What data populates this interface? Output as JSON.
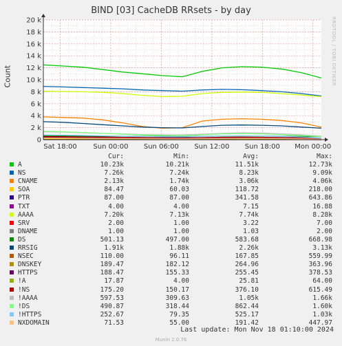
{
  "chart_data": {
    "type": "line",
    "title": "BIND [03] CacheDB RRsets - by day",
    "ylabel": "Count",
    "watermark": "RRDTOOL / TOBI OETIKER",
    "ylim": [
      0,
      20000
    ],
    "y_ticks": [
      {
        "value": 0,
        "label": "0"
      },
      {
        "value": 2000,
        "label": "2 k"
      },
      {
        "value": 4000,
        "label": "4 k"
      },
      {
        "value": 6000,
        "label": "6 k"
      },
      {
        "value": 8000,
        "label": "8 k"
      },
      {
        "value": 10000,
        "label": "10 k"
      },
      {
        "value": 12000,
        "label": "12 k"
      },
      {
        "value": 14000,
        "label": "14 k"
      },
      {
        "value": 16000,
        "label": "16 k"
      },
      {
        "value": 18000,
        "label": "18 k"
      },
      {
        "value": 20000,
        "label": "20 k"
      }
    ],
    "x_range_hours": [
      0,
      33
    ],
    "x_ticks": [
      {
        "hour": 2,
        "label": "Sat 18:00"
      },
      {
        "hour": 8,
        "label": "Sun 00:00"
      },
      {
        "hour": 14,
        "label": "Sun 06:00"
      },
      {
        "hour": 20,
        "label": "Sun 12:00"
      },
      {
        "hour": 26,
        "label": "Sun 18:00"
      },
      {
        "hour": 32,
        "label": "Mon 00:00"
      }
    ],
    "grid": true,
    "columns": [
      "Cur:",
      "Min:",
      "Avg:",
      "Max:"
    ],
    "series": [
      {
        "name": "A",
        "color": "#00cc00",
        "values": [
          12500,
          12300,
          12100,
          11700,
          11300,
          11000,
          10700,
          10500,
          11400,
          12000,
          12200,
          12100,
          11800,
          11200,
          10300
        ]
      },
      {
        "name": "NS",
        "color": "#0066b3",
        "values": [
          8900,
          8800,
          8700,
          8600,
          8500,
          8300,
          8200,
          8100,
          8300,
          8400,
          8350,
          8200,
          8000,
          7700,
          7300
        ]
      },
      {
        "name": "CNAME",
        "color": "#ff8000",
        "values": [
          3800,
          3700,
          3600,
          3300,
          2800,
          2200,
          1900,
          2000,
          3100,
          3400,
          3500,
          3400,
          3200,
          2800,
          2100
        ]
      },
      {
        "name": "SOA",
        "color": "#ffcc00",
        "values": [
          100,
          110,
          120,
          120,
          130,
          120,
          110,
          100,
          110,
          120,
          130,
          120,
          110,
          100,
          85
        ]
      },
      {
        "name": "PTR",
        "color": "#330099",
        "values": [
          500,
          480,
          460,
          420,
          380,
          350,
          330,
          320,
          330,
          340,
          350,
          340,
          320,
          300,
          87
        ]
      },
      {
        "name": "TXT",
        "color": "#990099",
        "values": [
          6,
          7,
          8,
          9,
          8,
          7,
          6,
          6,
          7,
          8,
          9,
          8,
          7,
          6,
          4
        ]
      },
      {
        "name": "AAAA",
        "color": "#ccff00",
        "values": [
          8100,
          8050,
          8000,
          7900,
          7700,
          7400,
          7200,
          7250,
          7700,
          7900,
          7950,
          7900,
          7700,
          7450,
          7200
        ]
      },
      {
        "name": "SRV",
        "color": "#ff0000",
        "values": [
          4,
          4,
          3,
          3,
          3,
          3,
          3,
          3,
          3,
          4,
          4,
          3,
          3,
          3,
          2
        ]
      },
      {
        "name": "DNAME",
        "color": "#808080",
        "values": [
          1,
          1,
          1,
          1,
          1,
          1,
          1,
          1,
          1,
          1,
          1,
          1,
          1,
          1,
          1
        ]
      },
      {
        "name": "DS",
        "color": "#008f00",
        "values": [
          640,
          620,
          600,
          590,
          570,
          560,
          540,
          520,
          560,
          600,
          620,
          610,
          580,
          540,
          501
        ]
      },
      {
        "name": "RRSIG",
        "color": "#00487d",
        "values": [
          3000,
          2900,
          2700,
          2500,
          2300,
          2100,
          2000,
          1950,
          2200,
          2400,
          2450,
          2400,
          2300,
          2100,
          1910
        ]
      },
      {
        "name": "NSEC",
        "color": "#b35a00",
        "values": [
          400,
          380,
          300,
          220,
          180,
          150,
          130,
          120,
          160,
          200,
          240,
          220,
          180,
          140,
          110
        ]
      },
      {
        "name": "DNSKEY",
        "color": "#b38f00",
        "values": [
          300,
          290,
          280,
          270,
          260,
          250,
          240,
          230,
          250,
          270,
          280,
          270,
          250,
          220,
          189
        ]
      },
      {
        "name": "HTTPS",
        "color": "#6b006b",
        "values": [
          330,
          320,
          300,
          280,
          260,
          240,
          220,
          210,
          240,
          270,
          290,
          280,
          250,
          220,
          188
        ]
      },
      {
        "name": "!A",
        "color": "#8fb300",
        "values": [
          30,
          28,
          26,
          25,
          24,
          22,
          20,
          20,
          24,
          28,
          30,
          28,
          24,
          20,
          18
        ]
      },
      {
        "name": "!NS",
        "color": "#b30000",
        "values": [
          500,
          480,
          450,
          420,
          380,
          340,
          300,
          280,
          340,
          400,
          420,
          400,
          360,
          300,
          175
        ]
      },
      {
        "name": "!AAAA",
        "color": "#bebebe",
        "values": [
          1300,
          1250,
          1150,
          1050,
          950,
          850,
          800,
          780,
          900,
          1050,
          1150,
          1100,
          950,
          800,
          598
        ]
      },
      {
        "name": "!DS",
        "color": "#80ff80",
        "values": [
          1400,
          1300,
          1200,
          1050,
          900,
          780,
          700,
          680,
          800,
          950,
          1000,
          950,
          850,
          700,
          491
        ]
      },
      {
        "name": "!HTTPS",
        "color": "#80c9ff",
        "values": [
          800,
          760,
          700,
          640,
          580,
          520,
          480,
          460,
          540,
          620,
          660,
          620,
          540,
          440,
          253
        ]
      },
      {
        "name": "NXDOMAIN",
        "color": "#ffc080",
        "values": [
          260,
          250,
          230,
          210,
          190,
          170,
          150,
          140,
          170,
          200,
          220,
          210,
          180,
          140,
          72
        ]
      }
    ],
    "legend_rows": [
      {
        "name": "A",
        "color": "#00cc00",
        "cur": "10.23k",
        "min": "10.21k",
        "avg": "11.51k",
        "max": "12.73k"
      },
      {
        "name": "NS",
        "color": "#0066b3",
        "cur": "7.26k",
        "min": "7.24k",
        "avg": "8.23k",
        "max": "9.09k"
      },
      {
        "name": "CNAME",
        "color": "#ff8000",
        "cur": "2.13k",
        "min": "1.74k",
        "avg": "3.06k",
        "max": "4.06k"
      },
      {
        "name": "SOA",
        "color": "#ffcc00",
        "cur": "84.47",
        "min": "60.03",
        "avg": "118.72",
        "max": "218.00"
      },
      {
        "name": "PTR",
        "color": "#330099",
        "cur": "87.00",
        "min": "87.00",
        "avg": "341.58",
        "max": "643.86"
      },
      {
        "name": "TXT",
        "color": "#990099",
        "cur": "4.00",
        "min": "4.00",
        "avg": "7.15",
        "max": "16.88"
      },
      {
        "name": "AAAA",
        "color": "#ccff00",
        "cur": "7.20k",
        "min": "7.13k",
        "avg": "7.74k",
        "max": "8.28k"
      },
      {
        "name": "SRV",
        "color": "#ff0000",
        "cur": "2.00",
        "min": "1.00",
        "avg": "3.22",
        "max": "7.00"
      },
      {
        "name": "DNAME",
        "color": "#808080",
        "cur": "1.00",
        "min": "1.00",
        "avg": "1.03",
        "max": "2.00"
      },
      {
        "name": "DS",
        "color": "#008f00",
        "cur": "501.13",
        "min": "497.00",
        "avg": "583.68",
        "max": "668.98"
      },
      {
        "name": "RRSIG",
        "color": "#00487d",
        "cur": "1.91k",
        "min": "1.88k",
        "avg": "2.26k",
        "max": "3.13k"
      },
      {
        "name": "NSEC",
        "color": "#b35a00",
        "cur": "110.00",
        "min": "96.11",
        "avg": "167.85",
        "max": "559.99"
      },
      {
        "name": "DNSKEY",
        "color": "#b38f00",
        "cur": "189.47",
        "min": "182.12",
        "avg": "264.96",
        "max": "363.96"
      },
      {
        "name": "HTTPS",
        "color": "#6b006b",
        "cur": "188.47",
        "min": "155.33",
        "avg": "255.45",
        "max": "378.53"
      },
      {
        "name": "!A",
        "color": "#8fb300",
        "cur": "17.87",
        "min": "4.00",
        "avg": "25.81",
        "max": "64.00"
      },
      {
        "name": "!NS",
        "color": "#b30000",
        "cur": "175.20",
        "min": "150.17",
        "avg": "376.10",
        "max": "615.49"
      },
      {
        "name": "!AAAA",
        "color": "#bebebe",
        "cur": "597.53",
        "min": "309.63",
        "avg": "1.05k",
        "max": "1.66k"
      },
      {
        "name": "!DS",
        "color": "#80ff80",
        "cur": "490.87",
        "min": "318.44",
        "avg": "862.44",
        "max": "1.60k"
      },
      {
        "name": "!HTTPS",
        "color": "#80c9ff",
        "cur": "252.67",
        "min": "79.35",
        "avg": "525.17",
        "max": "1.03k"
      },
      {
        "name": "NXDOMAIN",
        "color": "#ffc080",
        "cur": "71.53",
        "min": "55.00",
        "avg": "191.42",
        "max": "447.97"
      }
    ],
    "last_update": "Last update: Mon Nov 18 01:10:00 2024",
    "footer": "Munin 2.0.76"
  }
}
